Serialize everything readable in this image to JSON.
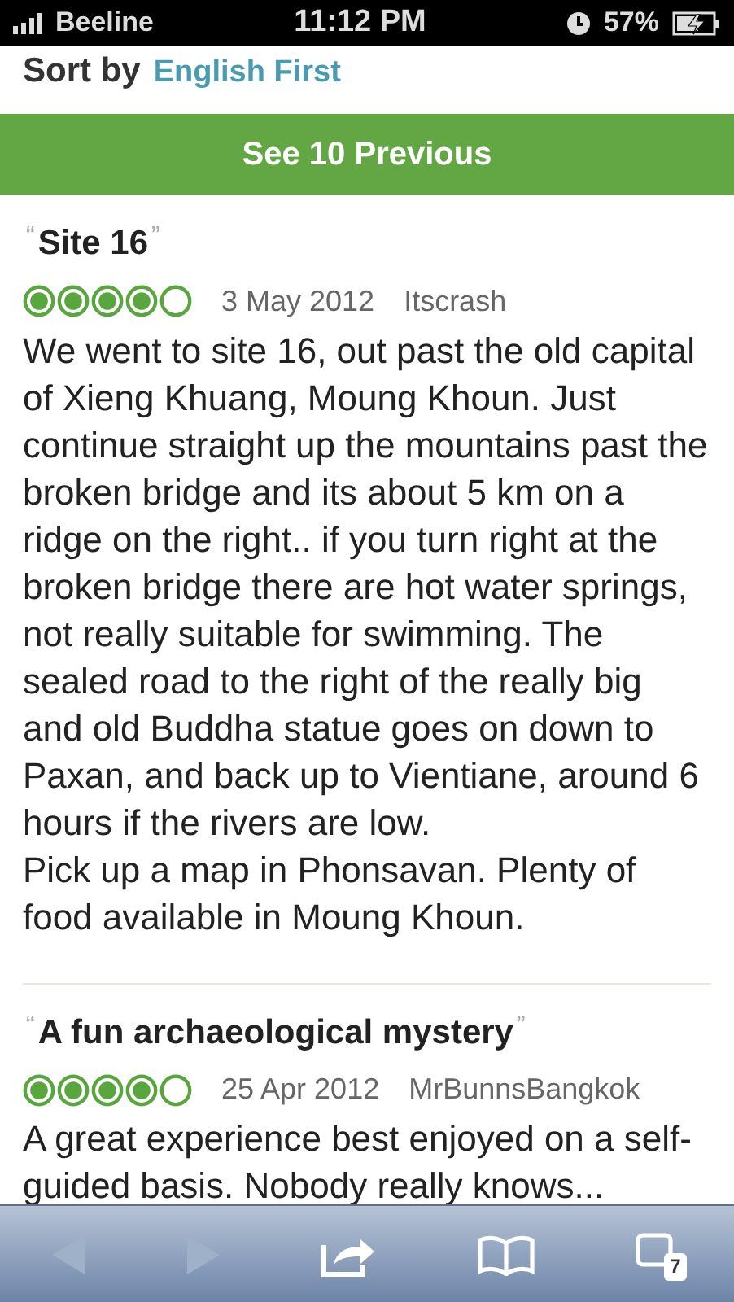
{
  "status_bar": {
    "carrier": "Beeline",
    "time": "11:12 PM",
    "battery": "57%"
  },
  "sort": {
    "label": "Sort by",
    "value": "English First"
  },
  "see_previous_button": "See 10 Previous",
  "reviews": [
    {
      "open_quote": "“",
      "title": "Site 16",
      "close_quote": "”",
      "stars": 4,
      "date": "3 May 2012",
      "author": "Itscrash",
      "text": "We went to site 16, out past the old capital of Xieng Khuang, Moung Khoun. Just continue straight up the mountains past the broken bridge and its about 5 km on a ridge on the right.. if you turn right at the broken bridge there are hot water springs, not really suitable for swimming. The sealed road to the right of the really big and old Buddha statue goes on down to Paxan, and back up to Vientiane, around 6 hours if the rivers are low.\nPick up a map in Phonsavan. Plenty of food available in Moung Khoun."
    },
    {
      "open_quote": "“",
      "title": "A fun archaeological mystery",
      "close_quote": "”",
      "stars": 4,
      "date": "25 Apr 2012",
      "author": "MrBunnsBangkok",
      "text": "A great experience best enjoyed on a self-guided basis. Nobody really knows..."
    }
  ],
  "toolbar": {
    "back_disabled": true,
    "forward_disabled": true,
    "tab_count": "7"
  }
}
